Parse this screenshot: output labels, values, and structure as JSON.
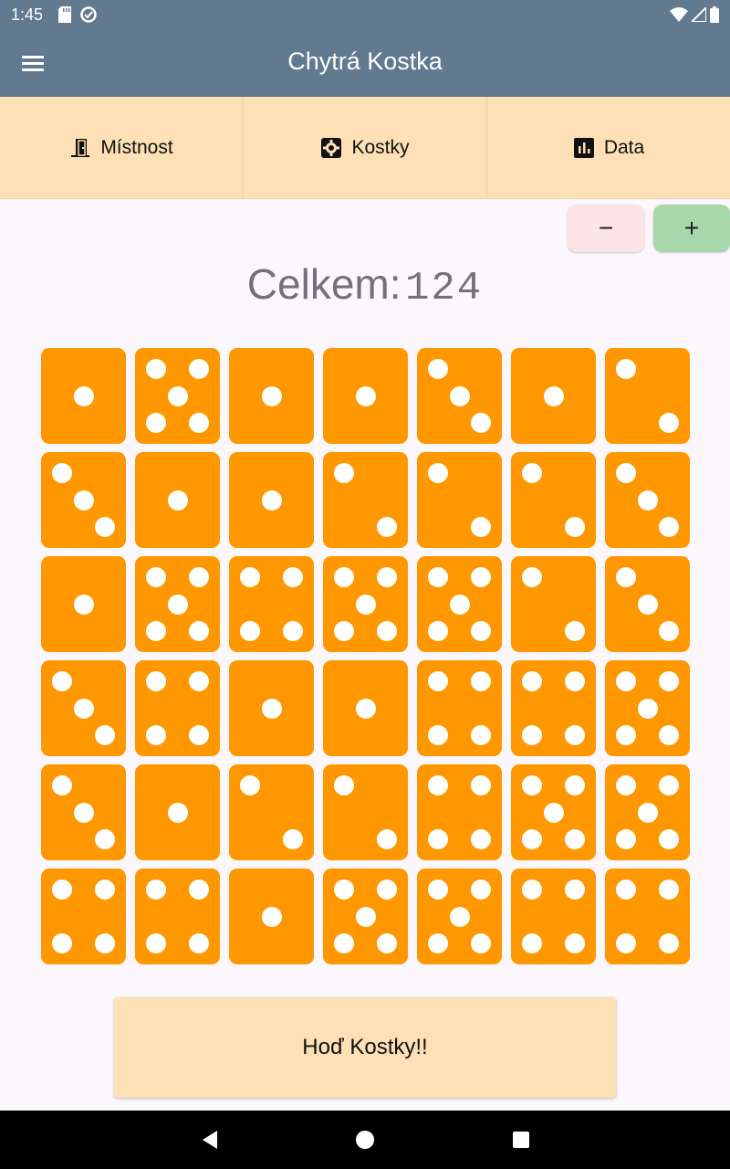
{
  "status_bar": {
    "time": "1:45"
  },
  "app_bar": {
    "title": "Chytrá Kostka"
  },
  "tabs": [
    {
      "label": "Místnost",
      "icon": "door-icon"
    },
    {
      "label": "Kostky",
      "icon": "gear-icon"
    },
    {
      "label": "Data",
      "icon": "bar-chart-icon"
    }
  ],
  "controls": {
    "minus_label": "−",
    "plus_label": "+"
  },
  "total": {
    "label": "Celkem:",
    "value": "124"
  },
  "dice": [
    1,
    5,
    1,
    1,
    3,
    1,
    2,
    3,
    1,
    1,
    2,
    2,
    2,
    3,
    1,
    5,
    4,
    5,
    5,
    2,
    3,
    3,
    4,
    1,
    1,
    4,
    4,
    5,
    3,
    1,
    2,
    2,
    4,
    5,
    5,
    4,
    4,
    1,
    5,
    5,
    4,
    4
  ],
  "roll_button": {
    "label": "Hoď Kostky!!"
  },
  "colors": {
    "die": "#ff9800",
    "app_bar": "#617a8f",
    "tab_bg": "#fde0b5",
    "plus": "#a8d8aa",
    "minus": "#fbe3e6"
  }
}
